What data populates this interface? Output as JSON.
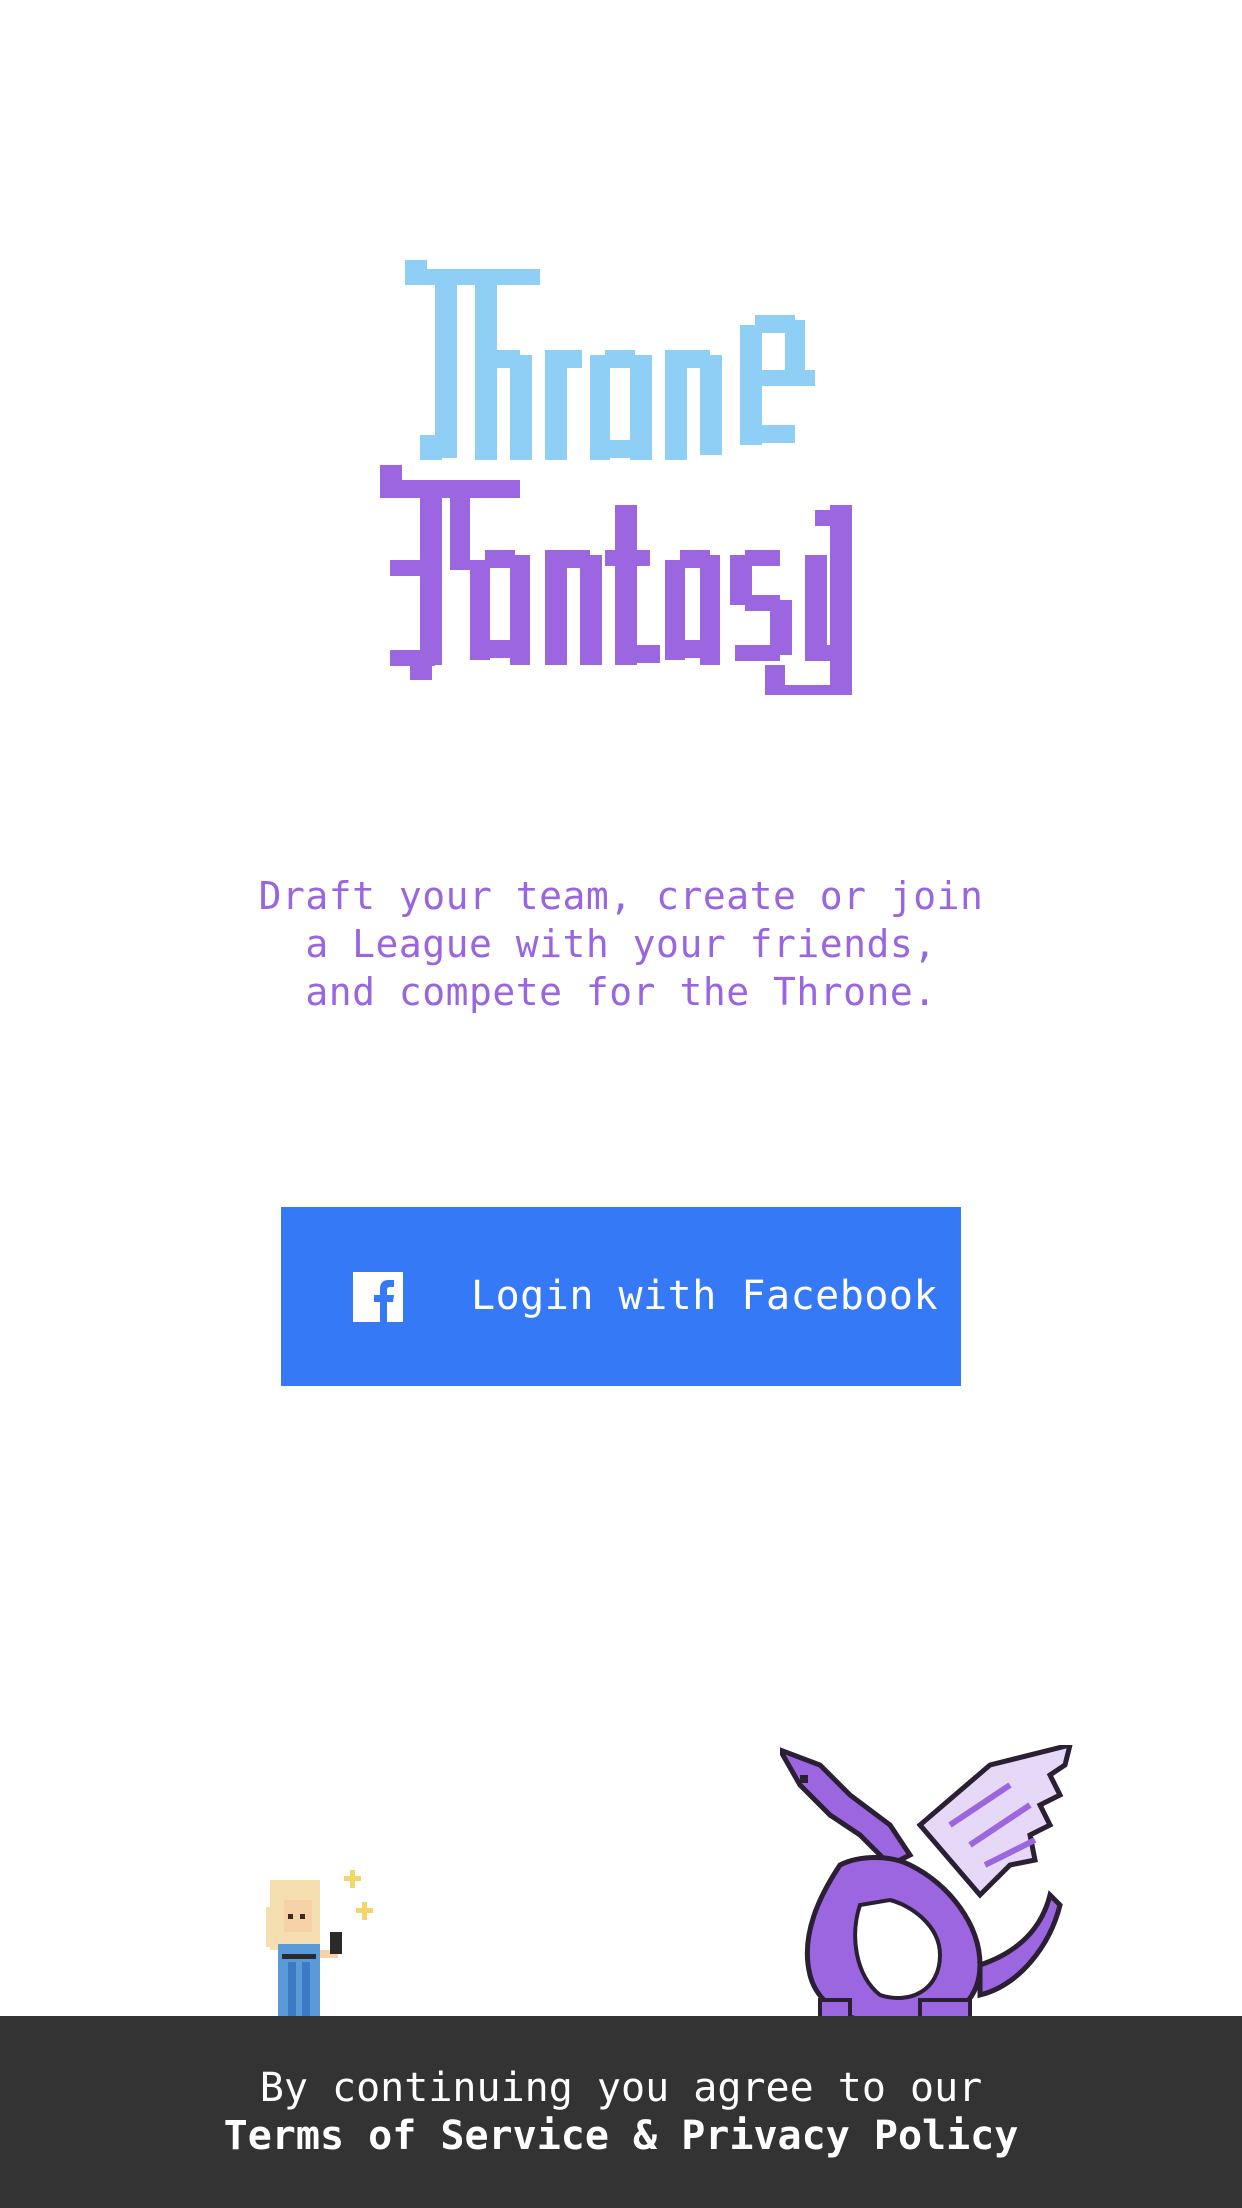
{
  "logo": {
    "line1": "Throne",
    "line2": "Fantasy",
    "color_top": "#8fcff6",
    "color_bottom": "#9b66df"
  },
  "tagline": "Draft your team, create or join\na League with your friends,\nand compete for the Throne.",
  "login": {
    "label": "Login with Facebook",
    "icon": "facebook-icon",
    "color": "#3579f6"
  },
  "footer": {
    "line1": "By continuing you agree to our",
    "link": "Terms of Service & Privacy Policy",
    "background": "#333333"
  },
  "illustrations": {
    "left": "princess-sprite",
    "right": "dragon-sprite"
  }
}
